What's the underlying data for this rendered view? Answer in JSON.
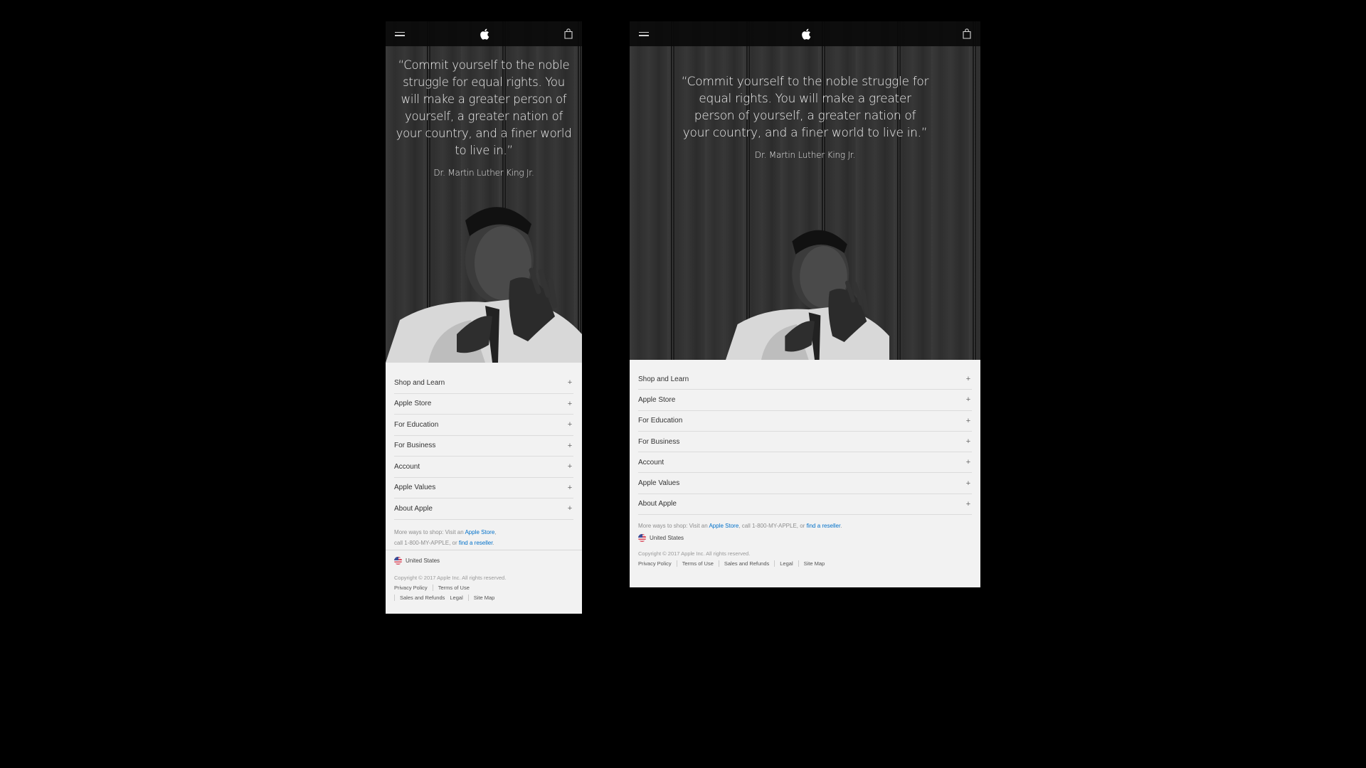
{
  "layouts": {
    "mobile": {
      "label": "mobile"
    },
    "tablet": {
      "label": "tablet"
    }
  },
  "nav": {
    "menu_icon": "hamburger-icon",
    "logo_icon": "apple-logo-icon",
    "bag_icon": "shopping-bag-icon"
  },
  "hero": {
    "quote": "“Commit yourself to the noble struggle for equal rights. You will make a greater person of yourself, a greater nation of your country, and a finer world to live in.”",
    "attribution": "Dr. Martin Luther King Jr.",
    "image_description": "Black-and-white photograph of Dr. Martin Luther King Jr. gesturing in front of wood paneling"
  },
  "footer": {
    "menu": [
      {
        "label": "Shop and Learn",
        "icon": "+"
      },
      {
        "label": "Apple Store",
        "icon": "+"
      },
      {
        "label": "For Education",
        "icon": "+"
      },
      {
        "label": "For Business",
        "icon": "+"
      },
      {
        "label": "Account",
        "icon": "+"
      },
      {
        "label": "Apple Values",
        "icon": "+"
      },
      {
        "label": "About Apple",
        "icon": "+"
      }
    ],
    "more_ways": {
      "prefix": "More ways to shop: Visit an ",
      "store_link": "Apple Store",
      "middle": ", call 1-800-MY-APPLE, or ",
      "reseller_link": "find a reseller",
      "suffix": ".",
      "mobile_line1_suffix": ",",
      "mobile_line2_prefix": "call 1-800-MY-APPLE, or "
    },
    "locale": {
      "label": "United States",
      "icon": "us-flag-icon"
    },
    "copyright": "Copyright © 2017 Apple Inc. All rights reserved.",
    "legal_links": [
      "Privacy Policy",
      "Terms of Use",
      "Sales and Refunds",
      "Legal",
      "Site Map"
    ]
  },
  "colors": {
    "page_background": "#000000",
    "nav_background": "#0a0a0a",
    "footer_background": "#f2f2f2",
    "link_blue": "#0070c9"
  }
}
